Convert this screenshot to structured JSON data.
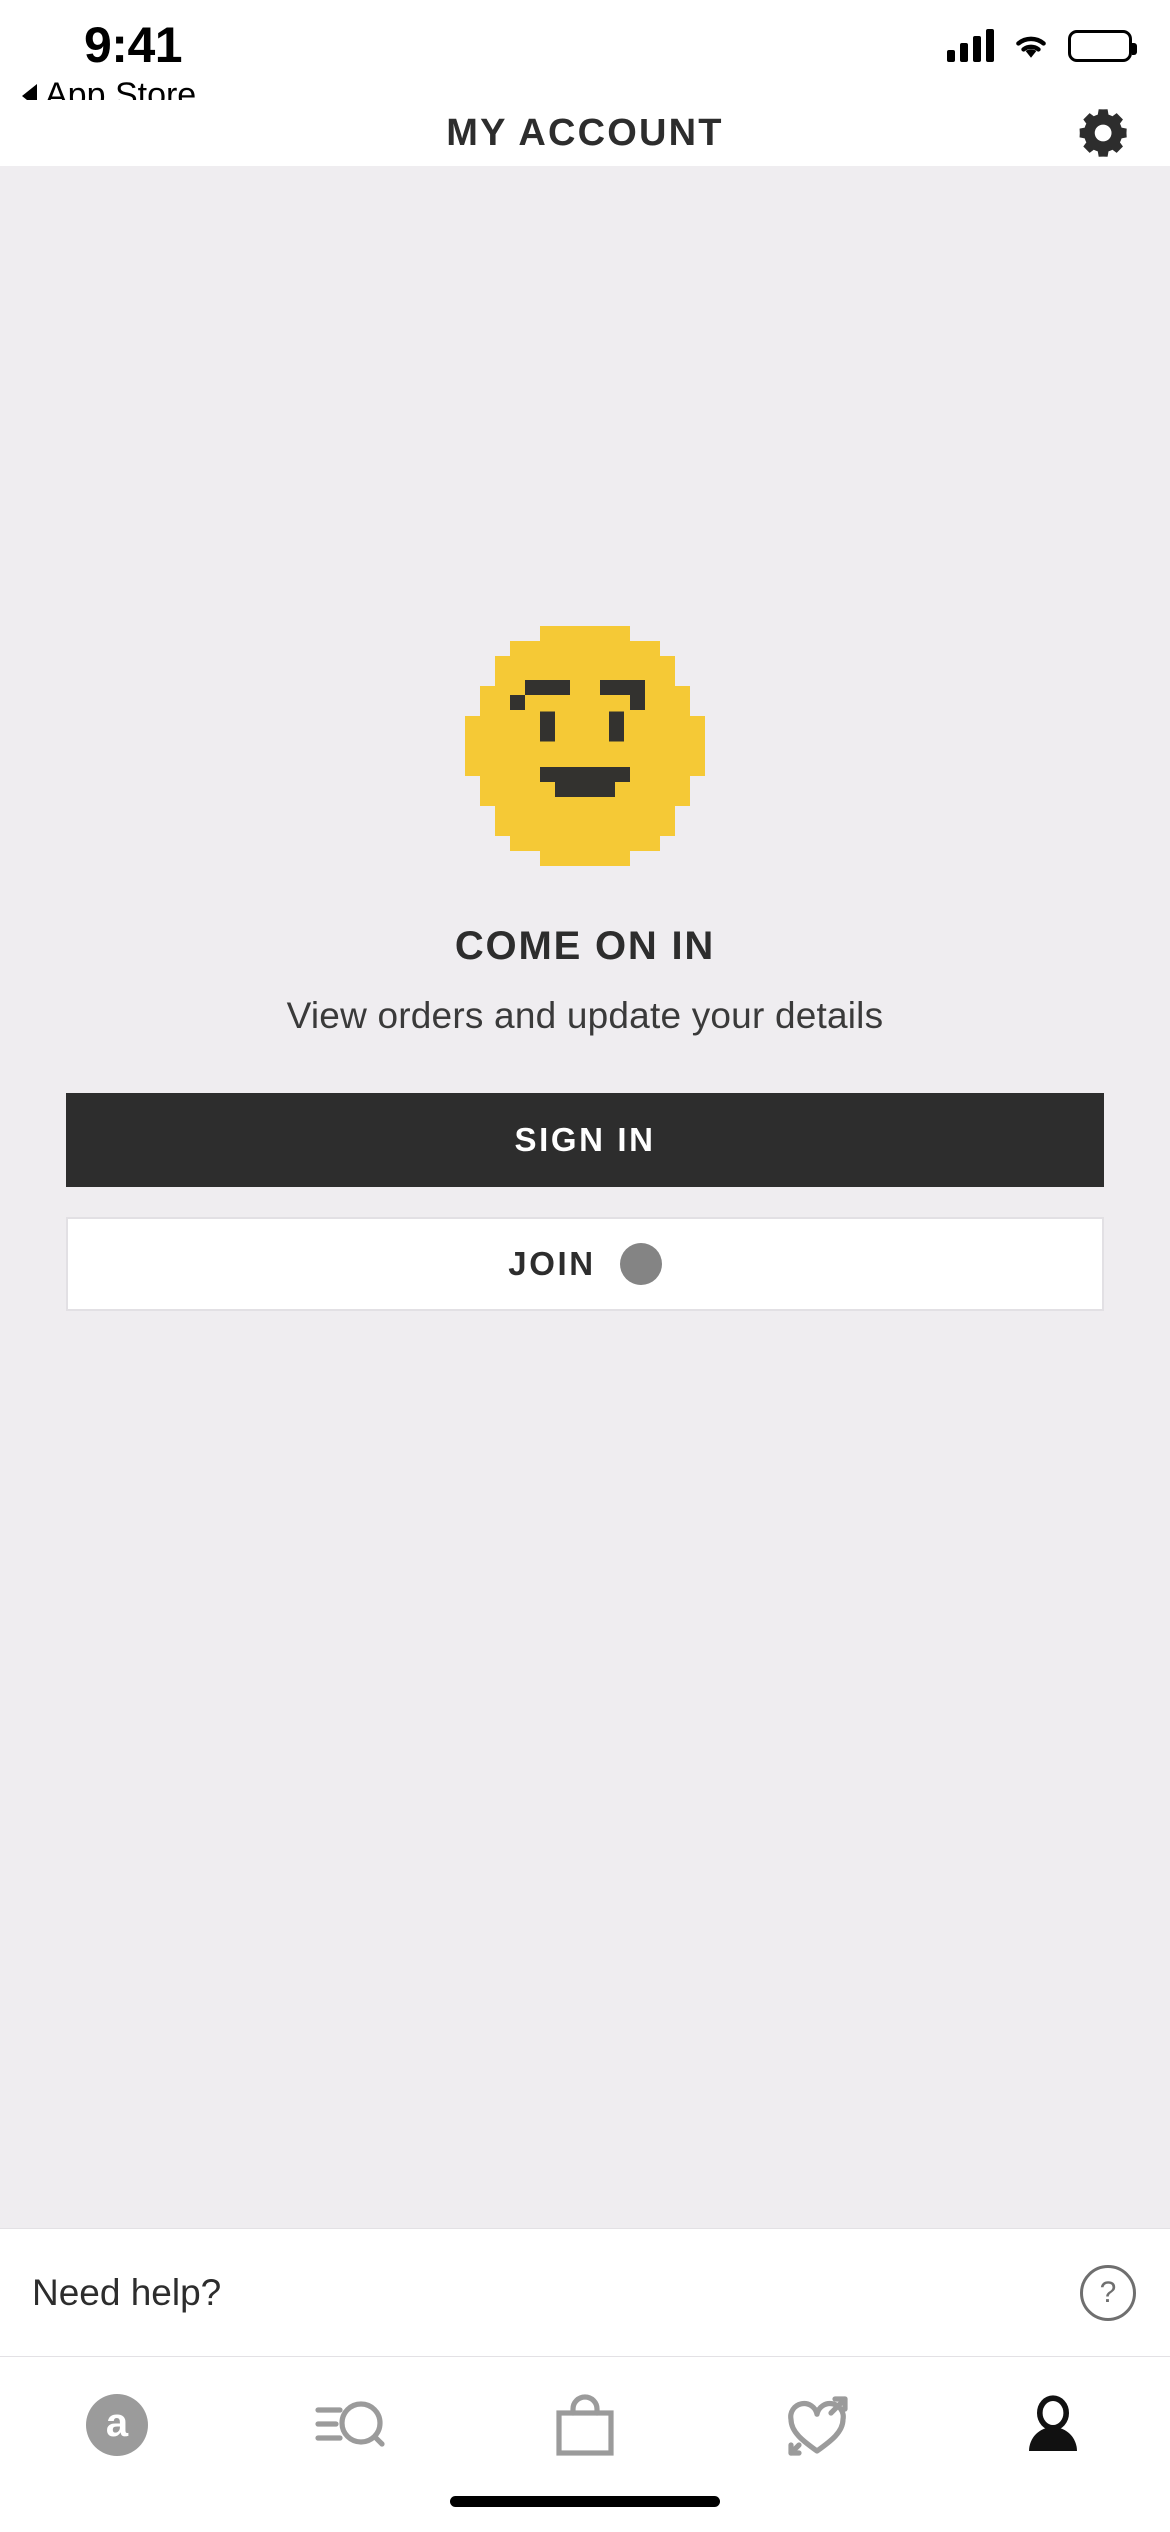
{
  "status_bar": {
    "time": "9:41",
    "back_label": "App Store",
    "back_icon": "triangle-left-icon",
    "signal_icon": "cellular-signal-icon",
    "wifi_icon": "wifi-icon",
    "battery_icon": "battery-full-icon"
  },
  "nav": {
    "title": "MY ACCOUNT",
    "settings_icon": "gear-icon"
  },
  "main": {
    "illustration": "pixel-smiley-face-icon",
    "headline": "COME ON IN",
    "subline": "View orders and update your details",
    "sign_in_label": "SIGN IN",
    "join_label": "JOIN",
    "join_spinner": "loading-spinner-icon"
  },
  "help": {
    "label": "Need help?",
    "icon": "question-mark-circle-icon",
    "icon_glyph": "?"
  },
  "tabs": [
    {
      "name": "home",
      "icon": "asos-logo-icon",
      "glyph": "a",
      "active": false
    },
    {
      "name": "search",
      "icon": "search-icon",
      "active": false
    },
    {
      "name": "bag",
      "icon": "shopping-bag-icon",
      "active": false
    },
    {
      "name": "saved",
      "icon": "heart-arrow-icon",
      "active": false
    },
    {
      "name": "account",
      "icon": "person-icon",
      "active": true
    }
  ],
  "colors": {
    "background": "#efedf0",
    "surface": "#ffffff",
    "primary_dark": "#2d2d2d",
    "emoji_yellow": "#f5c936",
    "spinner_gray": "#848484",
    "tab_inactive": "#9b9b9b",
    "tab_active": "#000000",
    "border": "#e3e1e5"
  }
}
